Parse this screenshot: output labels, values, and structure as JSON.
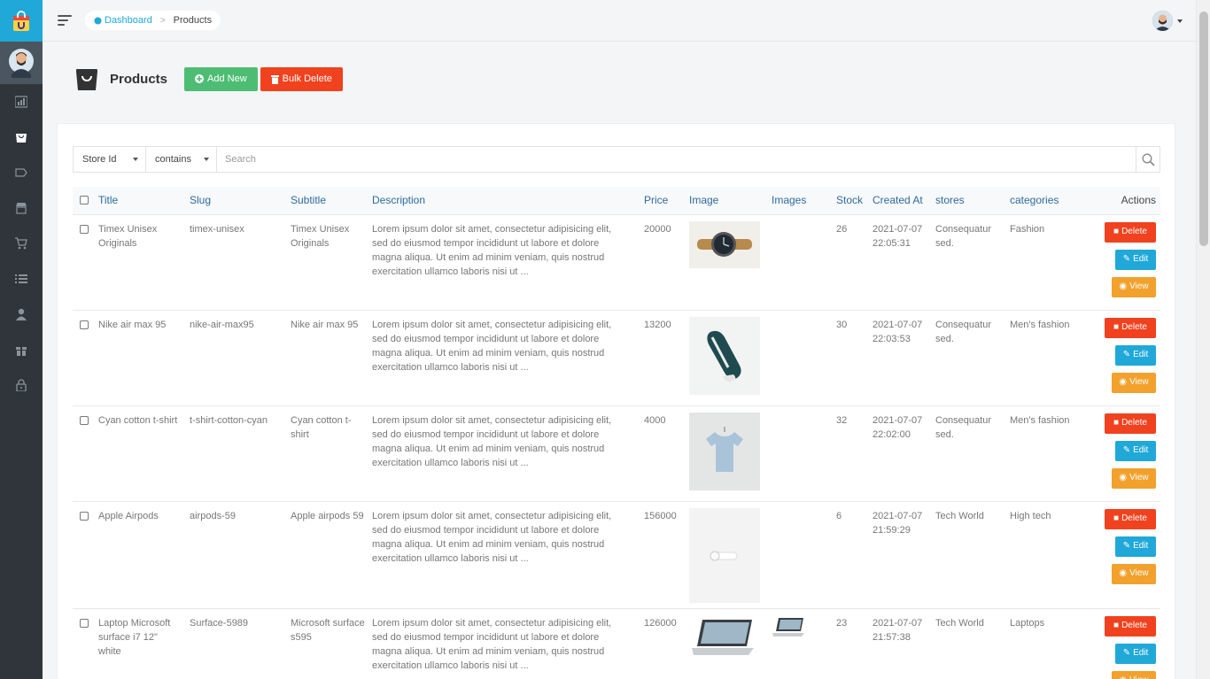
{
  "breadcrumb": {
    "home": "Dashboard",
    "current": "Products"
  },
  "page": {
    "title": "Products",
    "add_label": "Add New",
    "bulk_label": "Bulk Delete"
  },
  "filter": {
    "field": "Store Id",
    "operator": "contains",
    "placeholder": "Search"
  },
  "columns": [
    "Title",
    "Slug",
    "Subtitle",
    "Description",
    "Price",
    "Image",
    "Images",
    "Stock",
    "Created At",
    "stores",
    "categories",
    "Actions"
  ],
  "action_labels": {
    "delete": "Delete",
    "edit": "Edit",
    "view": "View"
  },
  "rows": [
    {
      "title": "Timex Unisex Originals",
      "slug": "timex-unisex",
      "subtitle": "Timex Unisex Originals",
      "description": "Lorem ipsum dolor sit amet, consectetur adipisicing elit, sed do eiusmod tempor incididunt ut labore et dolore magna aliqua. Ut enim ad minim veniam, quis nostrud exercitation ullamco laboris nisi ut ...",
      "price": "20000",
      "image": "watch",
      "stock": "26",
      "created_at": "2021-07-07 22:05:31",
      "store": "Consequatur sed.",
      "category": "Fashion"
    },
    {
      "title": "Nike air max 95",
      "slug": "nike-air-max95",
      "subtitle": "Nike air max 95",
      "description": "Lorem ipsum dolor sit amet, consectetur adipisicing elit, sed do eiusmod tempor incididunt ut labore et dolore magna aliqua. Ut enim ad minim veniam, quis nostrud exercitation ullamco laboris nisi ut ...",
      "price": "13200",
      "image": "sneaker",
      "stock": "30",
      "created_at": "2021-07-07 22:03:53",
      "store": "Consequatur sed.",
      "category": "Men's fashion"
    },
    {
      "title": "Cyan cotton t-shirt",
      "slug": "t-shirt-cotton-cyan",
      "subtitle": "Cyan cotton t-shirt",
      "description": "Lorem ipsum dolor sit amet, consectetur adipisicing elit, sed do eiusmod tempor incididunt ut labore et dolore magna aliqua. Ut enim ad minim veniam, quis nostrud exercitation ullamco laboris nisi ut ...",
      "price": "4000",
      "image": "tshirt",
      "stock": "32",
      "created_at": "2021-07-07 22:02:00",
      "store": "Consequatur sed.",
      "category": "Men's fashion"
    },
    {
      "title": "Apple Airpods",
      "slug": "airpods-59",
      "subtitle": "Apple airpods 59",
      "description": "Lorem ipsum dolor sit amet, consectetur adipisicing elit, sed do eiusmod tempor incididunt ut labore et dolore magna aliqua. Ut enim ad minim veniam, quis nostrud exercitation ullamco laboris nisi ut ...",
      "price": "156000",
      "image": "airpods",
      "stock": "6",
      "created_at": "2021-07-07 21:59:29",
      "store": "Tech World",
      "category": "High tech"
    },
    {
      "title": "Laptop Microsoft surface i7 12\" white",
      "slug": "Surface-5989",
      "subtitle": "Microsoft surface s595",
      "description": "Lorem ipsum dolor sit amet, consectetur adipisicing elit, sed do eiusmod tempor incididunt ut labore et dolore magna aliqua. Ut enim ad minim veniam, quis nostrud exercitation ullamco laboris nisi ut ...",
      "price": "126000",
      "image": "laptop",
      "stock": "23",
      "created_at": "2021-07-07 21:57:38",
      "store": "Tech World",
      "category": "Laptops"
    }
  ]
}
